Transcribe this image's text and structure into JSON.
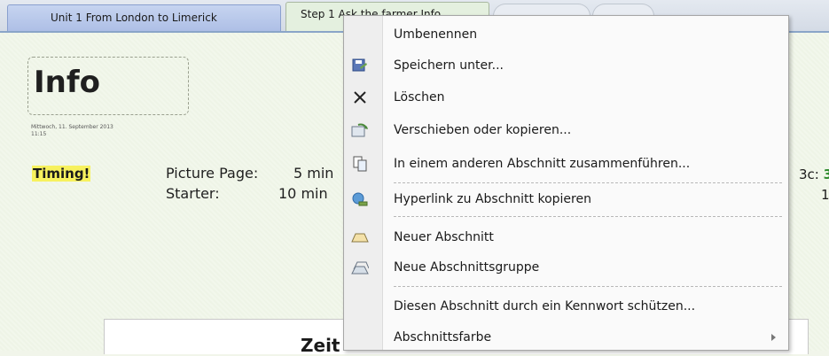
{
  "tabs": {
    "section_tab": "Unit 1 From London to Limerick",
    "page_tab": "Step 1 Ask the farmer Info"
  },
  "page": {
    "title": "Info",
    "date_line1": "Mittwoch, 11. September 2013",
    "date_line2": "11:15",
    "timing_label": "Timing!",
    "rows": [
      {
        "label": "Picture Page:",
        "value": "5 min"
      },
      {
        "label": "Starter:",
        "value": "10 min"
      }
    ],
    "edge_text": "3c:",
    "edge_num": "3",
    "edge_dot": "1",
    "lower_heading": "Zeit"
  },
  "menu": {
    "items": [
      {
        "label": "Umbenennen",
        "icon": "none-icon"
      },
      {
        "label": "Speichern unter...",
        "icon": "save-as-icon"
      },
      {
        "label": "Löschen",
        "icon": "delete-x-icon"
      },
      {
        "label": "Verschieben oder kopieren...",
        "icon": "move-copy-icon"
      },
      {
        "label": "In einem anderen Abschnitt zusammenführen...",
        "icon": "merge-section-icon"
      },
      {
        "label": "Hyperlink zu Abschnitt kopieren",
        "icon": "hyperlink-icon"
      },
      {
        "label": "Neuer Abschnitt",
        "icon": "new-section-icon"
      },
      {
        "label": "Neue Abschnittsgruppe",
        "icon": "new-section-group-icon"
      },
      {
        "label": "Diesen Abschnitt durch ein Kennwort schützen...",
        "icon": "none-icon"
      },
      {
        "label": "Abschnittsfarbe",
        "icon": "none-icon"
      }
    ]
  },
  "colors": {
    "tab_active": "#aebfe6",
    "page_bg": "#eef4e6",
    "highlight": "#f7f15e",
    "menu_bg": "#fafafa"
  }
}
